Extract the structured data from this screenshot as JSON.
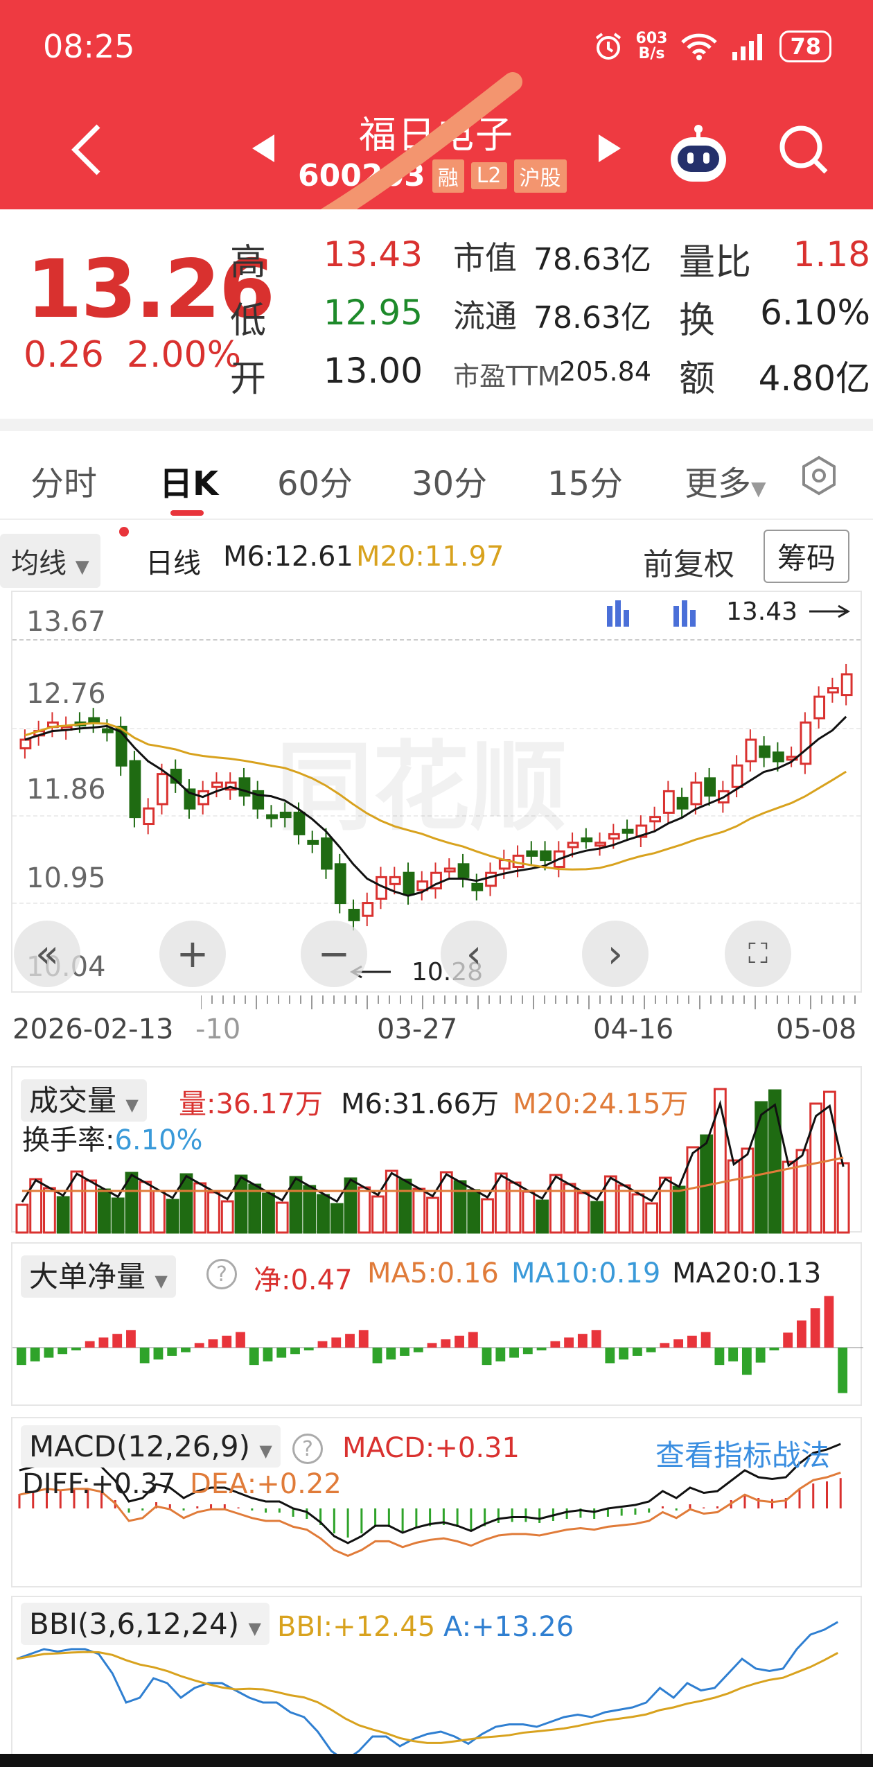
{
  "status_bar": {
    "time": "08:25",
    "net_speed": "603\nB/s",
    "battery": "78"
  },
  "nav": {
    "title": "福日电子",
    "code": "600203",
    "tags": [
      "融",
      "L2",
      "沪股"
    ]
  },
  "quote": {
    "price": "13.26",
    "change": "0.26",
    "change_pct": "2.00%",
    "high_label": "高",
    "high": "13.43",
    "low_label": "低",
    "low": "12.95",
    "open_label": "开",
    "open": "13.00",
    "mktcap_label": "市值",
    "mktcap": "78.63亿",
    "float_label": "流通",
    "float": "78.63亿",
    "pe_label": "市盈TTM",
    "pe": "205.84",
    "vr_label": "量比",
    "vr": "1.18",
    "turnover_label": "换",
    "turnover": "6.10%",
    "amount_label": "额",
    "amount": "4.80亿"
  },
  "tabs": [
    "分时",
    "日K",
    "60分",
    "30分",
    "15分",
    "更多"
  ],
  "ma_bar": {
    "dropdown": "均线",
    "daily": "日线",
    "m6": "M6:12.61",
    "m20": "M20:11.97",
    "adjust": "前复权",
    "chips": "筹码"
  },
  "kchart": {
    "y_labels": [
      "13.67",
      "12.76",
      "11.86",
      "10.95",
      "10.04"
    ],
    "high_marker": "13.43",
    "low_marker": "10.28",
    "dates": [
      "2026-02-13",
      "-10",
      "03-27",
      "04-16",
      "05-08"
    ]
  },
  "volume": {
    "title": "成交量",
    "vol": "量:36.17万",
    "m6": "M6:31.66万",
    "m20": "M20:24.15万",
    "turnover": "换手率:",
    "turnover_val": "6.10%"
  },
  "bigorder": {
    "title": "大单净量",
    "net": "净:0.47",
    "ma5": "MA5:0.16",
    "ma10": "MA10:0.19",
    "ma20": "MA20:0.13"
  },
  "macd": {
    "title": "MACD(12,26,9)",
    "macd": "MACD:+0.31",
    "link": "查看指标战法",
    "diff": "DIFF:+0.37",
    "dea": "DEA:+0.22"
  },
  "bbi": {
    "title": "BBI(3,6,12,24)",
    "bbi": "BBI:+12.45",
    "a": "A:+13.26"
  },
  "colors": {
    "up": "#d9312f",
    "down": "#1f6b12",
    "header": "#ee3a41",
    "ma20": "#e0a82e"
  }
}
